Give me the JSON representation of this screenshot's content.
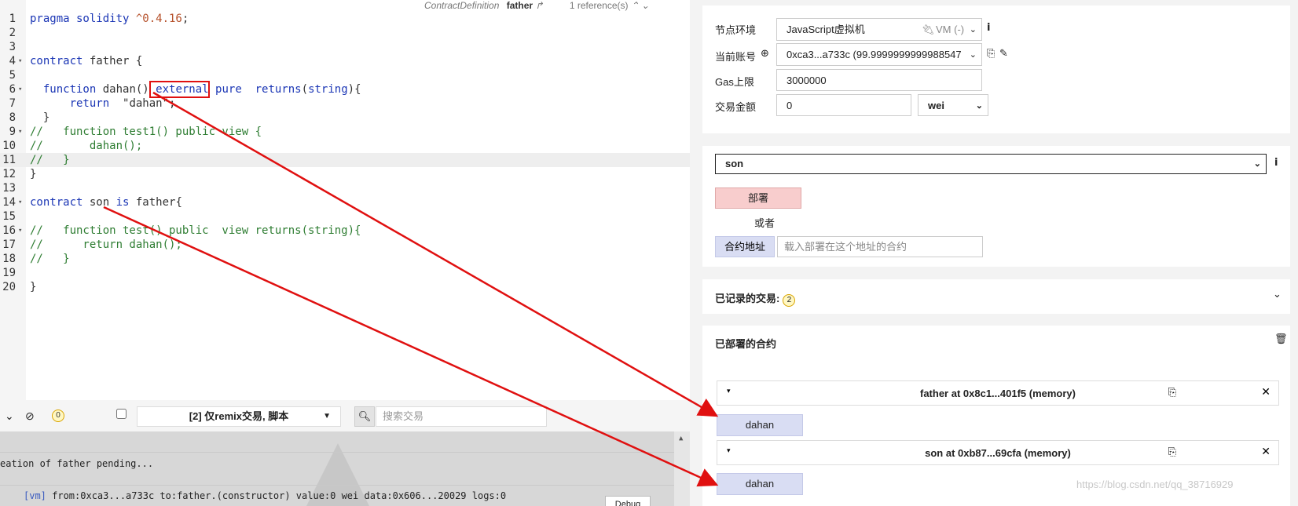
{
  "editor": {
    "top_info": {
      "context": "ContractDefinition",
      "name": "father",
      "references": "1 reference(s)"
    },
    "lines": [
      {
        "n": "1",
        "fold": "",
        "segs": [
          [
            "kw",
            "pragma solidity "
          ],
          [
            "num",
            "^0.4.16"
          ],
          [
            "str",
            ";"
          ]
        ]
      },
      {
        "n": "2",
        "fold": "",
        "segs": []
      },
      {
        "n": "3",
        "fold": "",
        "segs": []
      },
      {
        "n": "4",
        "fold": "▾",
        "segs": [
          [
            "kw",
            "contract"
          ],
          [
            "str",
            " father {"
          ]
        ]
      },
      {
        "n": "5",
        "fold": "",
        "segs": []
      },
      {
        "n": "6",
        "fold": "▾",
        "segs": [
          [
            "str",
            "  "
          ],
          [
            "kw",
            "function"
          ],
          [
            "str",
            " dahan() "
          ],
          [
            "kw",
            "external"
          ],
          [
            "str",
            " "
          ],
          [
            "kw",
            "pure"
          ],
          [
            "str",
            "  "
          ],
          [
            "kw",
            "returns"
          ],
          [
            "str",
            "("
          ],
          [
            "kw",
            "string"
          ],
          [
            "str",
            "){"
          ]
        ]
      },
      {
        "n": "7",
        "fold": "",
        "segs": [
          [
            "str",
            "      "
          ],
          [
            "kw",
            "return"
          ],
          [
            "str",
            "  \"dahan\";"
          ]
        ]
      },
      {
        "n": "8",
        "fold": "",
        "segs": [
          [
            "str",
            "  }"
          ]
        ]
      },
      {
        "n": "9",
        "fold": "▾",
        "segs": [
          [
            "cm",
            "//   function test1() public view {"
          ]
        ]
      },
      {
        "n": "10",
        "fold": "",
        "segs": [
          [
            "cm",
            "//       dahan();"
          ]
        ]
      },
      {
        "n": "11",
        "fold": "",
        "segs": [
          [
            "cm",
            "//   }"
          ]
        ]
      },
      {
        "n": "12",
        "fold": "",
        "segs": [
          [
            "str",
            "}"
          ]
        ]
      },
      {
        "n": "13",
        "fold": "",
        "segs": []
      },
      {
        "n": "14",
        "fold": "▾",
        "segs": [
          [
            "kw",
            "contract"
          ],
          [
            "str",
            " son "
          ],
          [
            "kw",
            "is"
          ],
          [
            "str",
            " father{"
          ]
        ]
      },
      {
        "n": "15",
        "fold": "",
        "segs": []
      },
      {
        "n": "16",
        "fold": "▾",
        "segs": [
          [
            "cm",
            "//   function test() public  view returns(string){"
          ]
        ]
      },
      {
        "n": "17",
        "fold": "",
        "segs": [
          [
            "cm",
            "//      return dahan();"
          ]
        ]
      },
      {
        "n": "18",
        "fold": "",
        "segs": [
          [
            "cm",
            "//   }"
          ]
        ]
      },
      {
        "n": "19",
        "fold": "",
        "segs": []
      },
      {
        "n": "20",
        "fold": "",
        "segs": [
          [
            "str",
            "}"
          ]
        ]
      }
    ],
    "highlighted_line": 11
  },
  "terminal": {
    "badge_count": "0",
    "filter_label": "[2] 仅remix交易, 脚本",
    "search_placeholder": "搜索交易",
    "log_line": "eation of father pending...",
    "tx_tag": "[vm]",
    "tx_line": " from:0xca3...a733c to:father.(constructor) value:0 wei data:0x606...20029 logs:0",
    "debug_label": "Debug"
  },
  "run": {
    "env_label": "节点环境",
    "env_value": "JavaScript虚拟机",
    "env_vm": "VM (-)",
    "account_label": "当前账号",
    "account_value": "0xca3...a733c (99.9999999999988547",
    "gas_label": "Gas上限",
    "gas_value": "3000000",
    "value_label": "交易金额",
    "value_amount": "0",
    "value_unit": "wei",
    "contract_select": "son",
    "deploy_label": "部署",
    "or_label": "或者",
    "at_address_label": "合约地址",
    "at_address_placeholder": "载入部署在这个地址的合约",
    "recorded_label": "已记录的交易:",
    "recorded_count": "2",
    "deployed_label": "已部署的合约",
    "instances": [
      {
        "title": "father at 0x8c1...401f5 (memory)",
        "fn": "dahan"
      },
      {
        "title": "son at 0xb87...69cfa (memory)",
        "fn": "dahan"
      }
    ]
  },
  "watermark": "https://blog.csdn.net/qq_38716929",
  "colors": {
    "arrow": "#e01010",
    "deploy_button": "#f8cdcd",
    "function_button": "#d9ddf3",
    "keyword": "#1b36b5",
    "comment": "#2e7d32"
  }
}
